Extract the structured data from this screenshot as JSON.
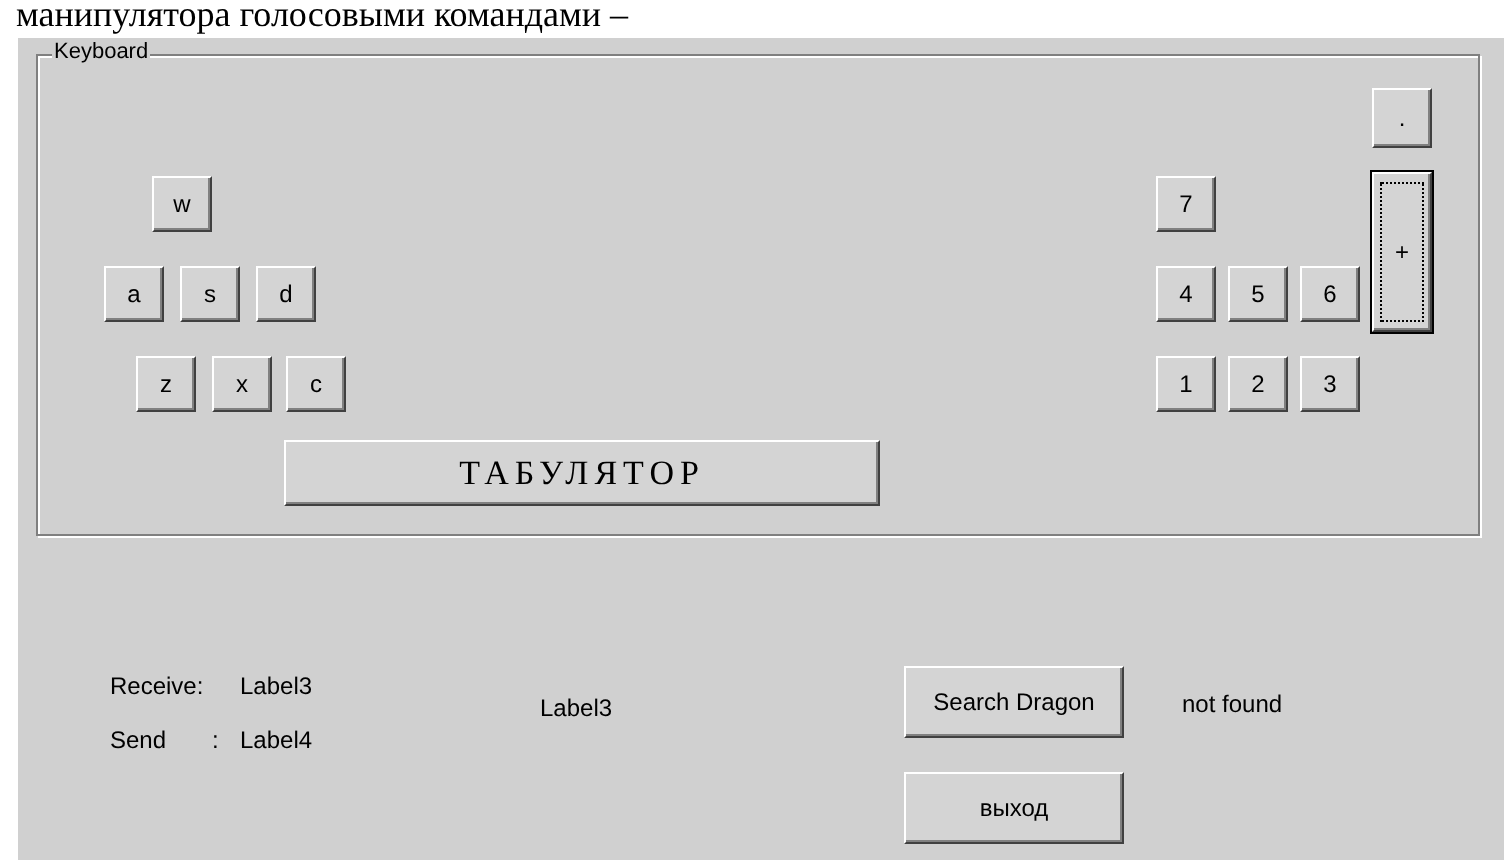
{
  "document_text": "манипулятора голосовыми командами –",
  "keyboard": {
    "title": "Keyboard",
    "letter_keys": [
      {
        "label": "w"
      },
      {
        "label": "a"
      },
      {
        "label": "s"
      },
      {
        "label": "d"
      },
      {
        "label": "z"
      },
      {
        "label": "x"
      },
      {
        "label": "c"
      }
    ],
    "tab_button": {
      "label": "ТАБУЛЯТОР"
    },
    "numpad_keys": [
      {
        "label": ".",
        "focused": false
      },
      {
        "label": "+",
        "focused": true
      },
      {
        "label": "7",
        "focused": false
      },
      {
        "label": "4",
        "focused": false
      },
      {
        "label": "5",
        "focused": false
      },
      {
        "label": "6",
        "focused": false
      },
      {
        "label": "1",
        "focused": false
      },
      {
        "label": "2",
        "focused": false
      },
      {
        "label": "3",
        "focused": false
      }
    ]
  },
  "status": {
    "receive_label": "Receive:",
    "receive_value": "Label3",
    "send_label": "Send",
    "send_colon": ":",
    "send_value": "Label4",
    "center_label": "Label3",
    "not_found": "not found"
  },
  "buttons": [
    {
      "label": "Search Dragon"
    },
    {
      "label": "выход"
    }
  ]
}
